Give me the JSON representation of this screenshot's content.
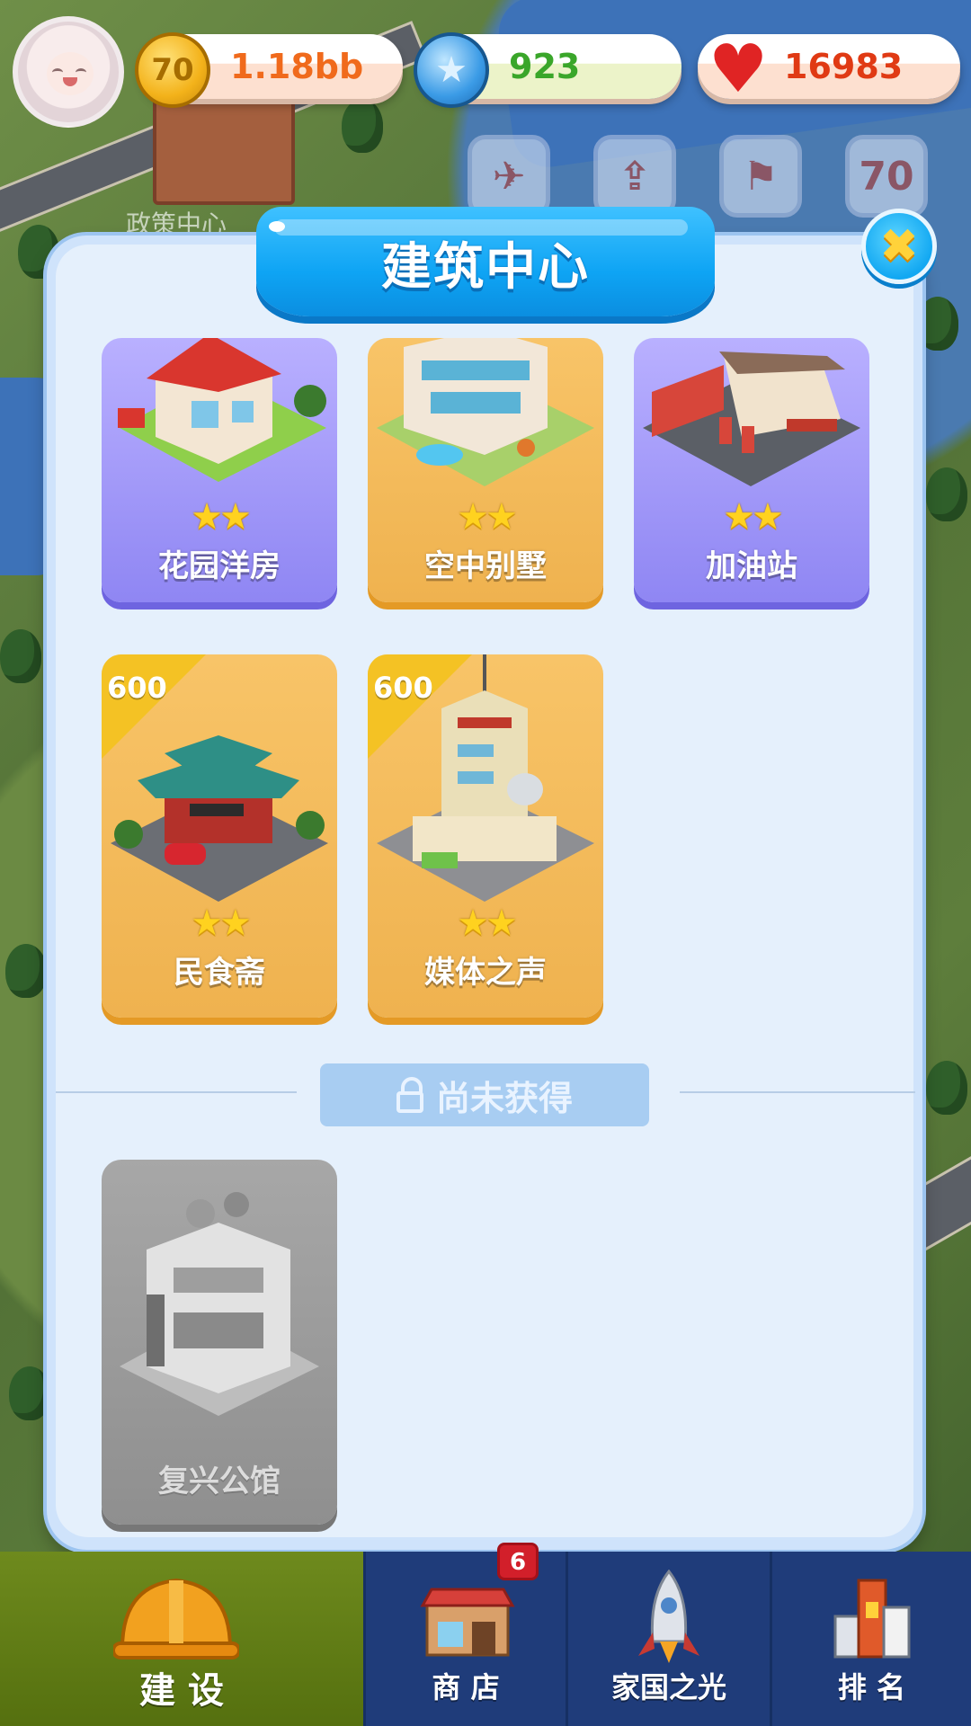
{
  "background": {
    "policy_center_label": "政策中心",
    "icon_70": "70"
  },
  "resources": {
    "coins": {
      "icon": "coin-icon",
      "coin_text": "70",
      "value": "1.18bb",
      "color": "#f06a1c"
    },
    "gems": {
      "icon": "star-gem-icon",
      "value": "923",
      "color": "#3aa62a"
    },
    "hearts": {
      "icon": "heart-icon",
      "value": "16983",
      "color": "#e03a14"
    }
  },
  "modal": {
    "title": "建筑中心",
    "close_icon": "✖",
    "owned_buildings": [
      {
        "name": "花园洋房",
        "theme": "purple",
        "stars": "★★"
      },
      {
        "name": "空中别墅",
        "theme": "gold",
        "stars": "★★"
      },
      {
        "name": "加油站",
        "theme": "purple",
        "stars": "★★"
      },
      {
        "name": "民食斋",
        "theme": "gold",
        "stars": "★★",
        "price": "600"
      },
      {
        "name": "媒体之声",
        "theme": "gold",
        "stars": "★★",
        "price": "600"
      }
    ],
    "locked_section_label": "尚未获得",
    "locked_buildings": [
      {
        "name": "复兴公馆"
      }
    ]
  },
  "bottom_nav": {
    "items": [
      {
        "label": "建 设",
        "icon": "hard-hat-icon",
        "active": true
      },
      {
        "label": "商 店",
        "icon": "shop-icon",
        "active": false
      },
      {
        "label": "家国之光",
        "icon": "rocket-icon",
        "active": false
      },
      {
        "label": "排 名",
        "icon": "ranking-tower-icon",
        "active": false
      }
    ],
    "shop_badge": "6"
  }
}
